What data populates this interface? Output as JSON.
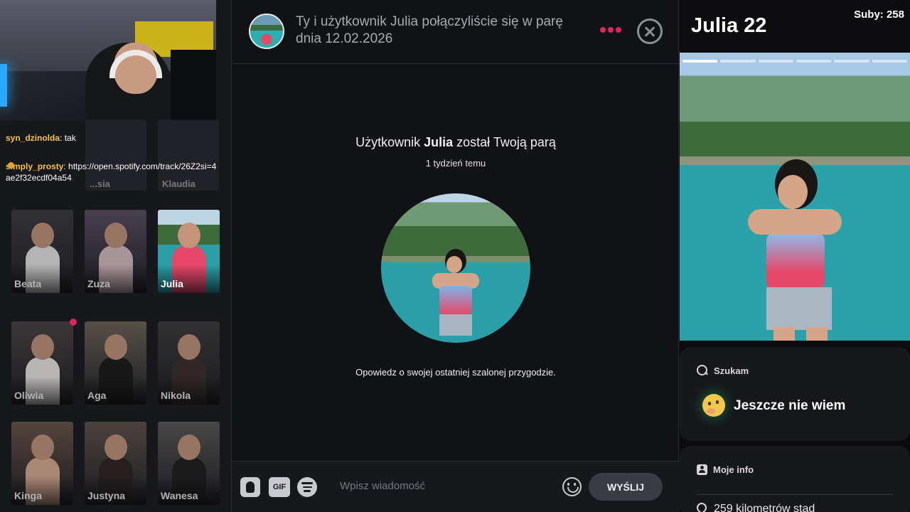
{
  "chat": [
    {
      "user": "syn_dzinolda",
      "text": "tak"
    },
    {
      "user": "simply_prosty",
      "text": "https://open.spotify.com/track/26Z2si=4ae2f32ecdf04a54"
    }
  ],
  "ghost_cards": [
    "...sia",
    "Klaudia"
  ],
  "matches": [
    {
      "name": "Beata",
      "active": false,
      "notif": false,
      "bg": "#3a3a3f",
      "body": "#e9e9e9"
    },
    {
      "name": "Zuza",
      "active": false,
      "notif": false,
      "bg": "#5a4e60",
      "body": "#d9bfc4"
    },
    {
      "name": "Julia",
      "active": true,
      "notif": false,
      "bg": "#2a8f96",
      "body": "#e6486a"
    },
    {
      "name": "Oliwia",
      "active": false,
      "notif": true,
      "bg": "#4a4243",
      "body": "#f0ecea"
    },
    {
      "name": "Aga",
      "active": false,
      "notif": false,
      "bg": "#6d6458",
      "body": "#191919"
    },
    {
      "name": "Nikola",
      "active": false,
      "notif": false,
      "bg": "#3b3838",
      "body": "#3a2e2b"
    },
    {
      "name": "Kinga",
      "active": false,
      "notif": false,
      "bg": "#6a5449",
      "body": "#d9ac91"
    },
    {
      "name": "Justyna",
      "active": false,
      "notif": false,
      "bg": "#5e514a",
      "body": "#2a2222"
    },
    {
      "name": "Wanesa",
      "active": false,
      "notif": false,
      "bg": "#5a5857",
      "body": "#1d1d1d"
    }
  ],
  "header": {
    "match_text": "Ty i użytkownik Julia połączyliście się w parę dnia 12.02.2026"
  },
  "match": {
    "title_pre": "Użytkownik ",
    "title_name": "Julia",
    "title_post": " został Twoją parą",
    "time": "1 tydzień temu",
    "prompt": "Opowiedz o swojej ostatniej szalonej przygodzie."
  },
  "composer": {
    "gif_label": "GIF",
    "placeholder": "Wpisz wiadomość",
    "send_label": "WYŚLIJ"
  },
  "profile": {
    "subs": "Suby: 258",
    "name": "Julia 22",
    "photo_count": 6,
    "photo_index": 0,
    "seeking_title": "Szukam",
    "seeking_value": "Jeszcze nie wiem",
    "info_title": "Moje info",
    "distance": "259 kilometrów stąd"
  },
  "colors": {
    "accent": "#e0245e",
    "chat_user": "#f3c33b"
  }
}
